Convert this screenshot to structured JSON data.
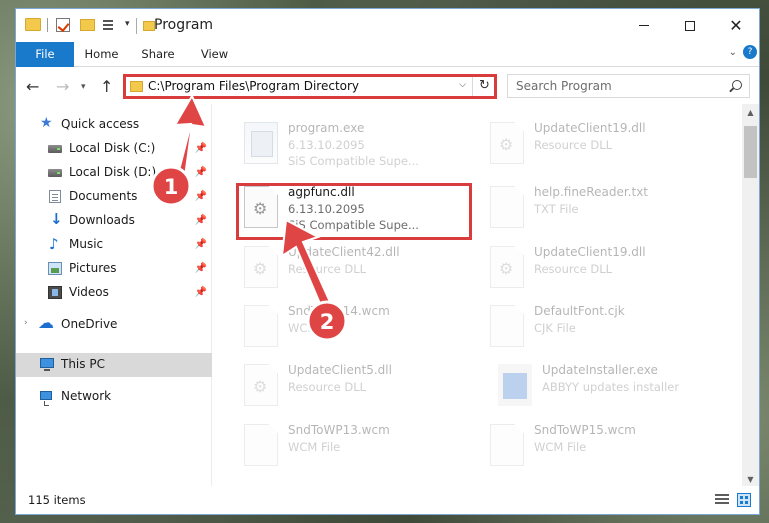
{
  "window": {
    "title": "Program",
    "controls": {
      "minimize": "minimize",
      "maximize": "maximize",
      "close": "close"
    }
  },
  "ribbon": {
    "tabs": [
      {
        "label": "File"
      },
      {
        "label": "Home"
      },
      {
        "label": "Share"
      },
      {
        "label": "View"
      }
    ]
  },
  "address_bar": {
    "path": "C:\\Program Files\\Program Directory"
  },
  "search": {
    "placeholder": "Search Program"
  },
  "sidebar": {
    "items": [
      {
        "label": "Quick access",
        "icon": "star-icon",
        "pinned": false
      },
      {
        "label": "Local Disk (C:)",
        "icon": "drive-icon",
        "pinned": true
      },
      {
        "label": "Local Disk (D:)",
        "icon": "drive-icon",
        "pinned": true
      },
      {
        "label": "Documents",
        "icon": "documents-icon",
        "pinned": true
      },
      {
        "label": "Downloads",
        "icon": "download-icon",
        "pinned": true
      },
      {
        "label": "Music",
        "icon": "music-icon",
        "pinned": true
      },
      {
        "label": "Pictures",
        "icon": "pictures-icon",
        "pinned": true
      },
      {
        "label": "Videos",
        "icon": "videos-icon",
        "pinned": true
      },
      {
        "label": "OneDrive",
        "icon": "cloud-icon",
        "pinned": false
      },
      {
        "label": "This PC",
        "icon": "computer-icon",
        "pinned": false,
        "selected": true
      },
      {
        "label": "Network",
        "icon": "network-icon",
        "pinned": false
      }
    ]
  },
  "files": [
    {
      "name": "program.exe",
      "line1": "6.13.10.2095",
      "line2": "SiS Compatible Supe...",
      "icon": "exe-icon",
      "faded": true
    },
    {
      "name": "UpdateClient19.dll",
      "line1": "Resource DLL",
      "line2": "",
      "icon": "dll-icon",
      "faded": true
    },
    {
      "name": "agpfunc.dll",
      "line1": "6.13.10.2095",
      "line2": "SiS Compatible Supe...",
      "icon": "dll-icon",
      "faded": false,
      "highlighted": true
    },
    {
      "name": "help.fineReader.txt",
      "line1": "TXT File",
      "line2": "",
      "icon": "file-icon",
      "faded": true
    },
    {
      "name": "UpdateClient42.dll",
      "line1": "Resource DLL",
      "line2": "",
      "icon": "dll-icon",
      "faded": true
    },
    {
      "name": "UpdateClient19.dll",
      "line1": "Resource DLL",
      "line2": "",
      "icon": "dll-icon",
      "faded": true
    },
    {
      "name": "SndToWP14.wcm",
      "line1": "WCM File",
      "line2": "",
      "icon": "file-icon",
      "faded": true
    },
    {
      "name": "DefaultFont.cjk",
      "line1": "CJK File",
      "line2": "",
      "icon": "file-icon",
      "faded": true
    },
    {
      "name": "UpdateClient5.dll",
      "line1": "Resource DLL",
      "line2": "",
      "icon": "dll-icon",
      "faded": true
    },
    {
      "name": "UpdateInstaller.exe",
      "line1": "ABBYY updates installer",
      "line2": "",
      "icon": "installer-icon",
      "faded": true
    },
    {
      "name": "SndToWP13.wcm",
      "line1": "WCM File",
      "line2": "",
      "icon": "file-icon",
      "faded": true
    },
    {
      "name": "SndToWP15.wcm",
      "line1": "WCM File",
      "line2": "",
      "icon": "file-icon",
      "faded": true
    }
  ],
  "status_bar": {
    "item_count": "115 items"
  },
  "annotations": {
    "step1": "1",
    "step2": "2",
    "color": "#d93c3c"
  }
}
